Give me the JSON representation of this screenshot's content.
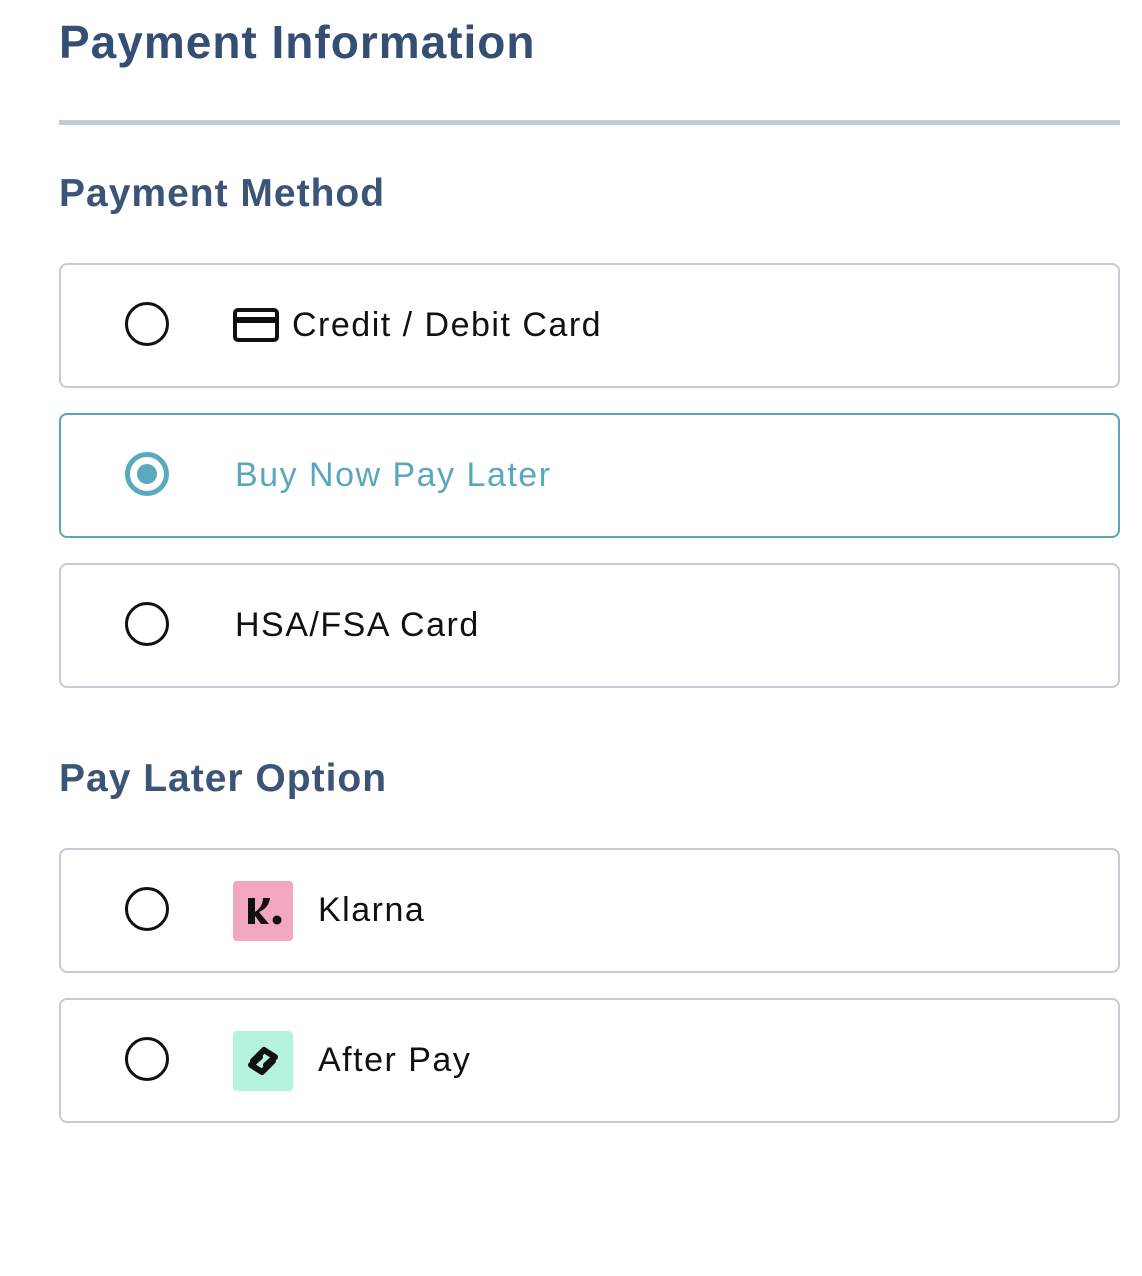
{
  "page": {
    "title": "Payment Information"
  },
  "payment_method": {
    "heading": "Payment Method",
    "options": [
      {
        "label": "Credit / Debit Card",
        "icon": "credit-card-icon",
        "selected": false
      },
      {
        "label": "Buy Now Pay Later",
        "icon": "",
        "selected": true
      },
      {
        "label": "HSA/FSA Card",
        "icon": "",
        "selected": false
      }
    ]
  },
  "pay_later": {
    "heading": "Pay Later Option",
    "options": [
      {
        "label": "Klarna",
        "icon": "klarna-logo",
        "selected": false
      },
      {
        "label": "After Pay",
        "icon": "afterpay-logo",
        "selected": false
      }
    ]
  },
  "colors": {
    "heading": "#354f74",
    "accent": "#5aa9bd",
    "border": "#c6ccd3",
    "klarna_bg": "#f2a7bf",
    "afterpay_bg": "#b5f3e0"
  }
}
